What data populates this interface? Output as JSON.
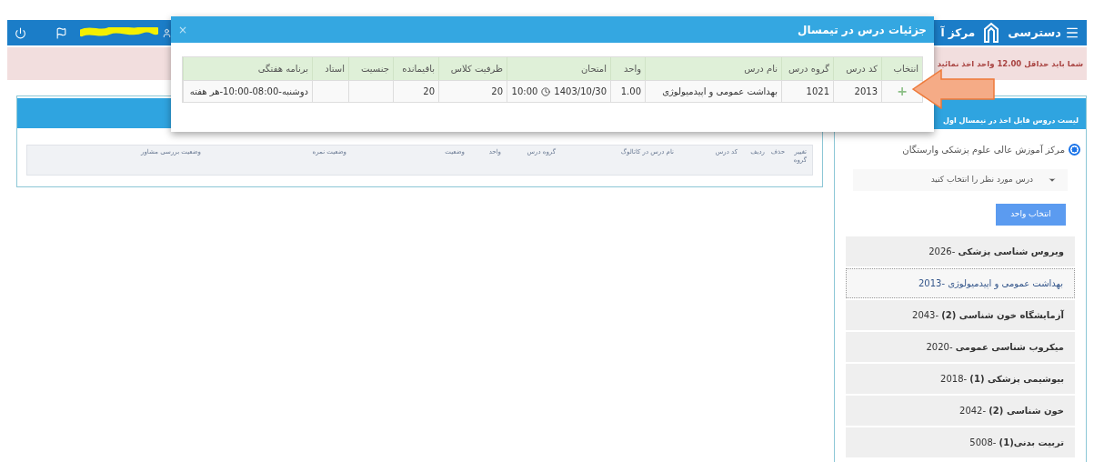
{
  "header": {
    "menu_label": "دسترسی",
    "title": "مرکز آ"
  },
  "alert": {
    "text": "شما باید حداقل 12.00 واحد اخذ نمائید"
  },
  "modal": {
    "title": "جزئیات درس در تیمسال",
    "close": "×",
    "columns": [
      "انتخاب",
      "کد درس",
      "گروه درس",
      "نام درس",
      "واحد",
      "امتحان",
      "ظرفیت کلاس",
      "باقیمانده",
      "جنسیت",
      "استاد",
      "برنامه هفتگی"
    ],
    "rows": [
      {
        "cells": [
          "+",
          "2013",
          "1021",
          "بهداشت عمومی و اپیدمیولوژی",
          "1.00",
          {
            "date": "1403/10/30",
            "time": "10:00"
          },
          "20",
          "20",
          null,
          null,
          "دوشنبه-08:00-10:00-هر هفته"
        ]
      }
    ]
  },
  "selected_courses": {
    "columns": [
      "تغییر گروه",
      "حذف",
      "ردیف",
      "کد درس",
      "نام درس در کاتالوگ",
      "گروه درس",
      "واحد",
      "وضعیت",
      "وضعیت نمره",
      "وضعیت بررسی مشاور"
    ]
  },
  "course_panel": {
    "title": "لیست دروس قابل اخذ در نیمسال اول",
    "radio": {
      "label": "مرکز آموزش عالی علوم پزشکی وارستگان",
      "selected": true
    },
    "dropdown": {
      "placeholder": "درس مورد نظر را انتخاب کنید"
    },
    "button": "انتخاب واحد",
    "items": [
      {
        "label": "**ویروس شناسی پزشکی** -2026",
        "selected": false
      },
      {
        "label": "بهداشت عمومی و اپیدمیولوژی -2013",
        "selected": true
      },
      {
        "label": "**آزمایشگاه خون شناسی (2)** -2043",
        "selected": false
      },
      {
        "label": "**میکروب شناسی عمومی** -2020",
        "selected": false
      },
      {
        "label": "**بیوشیمی پزشکی (1)** -2018",
        "selected": false
      },
      {
        "label": "**خون شناسی (2)** -2042",
        "selected": false
      },
      {
        "label": "**تربیت بدنی(1)** -5008",
        "selected": false
      }
    ]
  }
}
